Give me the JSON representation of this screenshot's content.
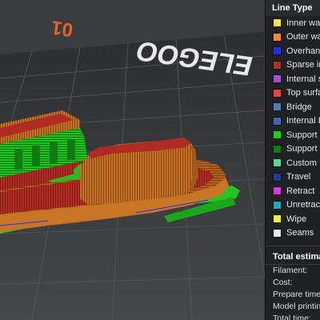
{
  "bed": {
    "logo_text": "ELEGOO",
    "plate_number": "01",
    "accent_color": "#e8622a"
  },
  "legend": {
    "title": "Line Type",
    "items": [
      {
        "label": "Inner wal",
        "color": "#ffe24a",
        "icon": "square-swatch"
      },
      {
        "label": "Outer wal",
        "color": "#f08a3a",
        "icon": "square-swatch"
      },
      {
        "label": "Overhang",
        "color": "#2430e0",
        "icon": "square-swatch"
      },
      {
        "label": "Sparse in",
        "color": "#a8332c",
        "icon": "square-swatch"
      },
      {
        "label": "Internal s",
        "color": "#a34fd6",
        "icon": "square-swatch"
      },
      {
        "label": "Top surfa",
        "color": "#e0463d",
        "icon": "square-swatch"
      },
      {
        "label": "Bridge",
        "color": "#4f7fb0",
        "icon": "square-swatch"
      },
      {
        "label": "Internal B",
        "color": "#3a6aa8",
        "icon": "square-swatch"
      },
      {
        "label": "Support",
        "color": "#19d11c",
        "icon": "square-swatch"
      },
      {
        "label": "Support i",
        "color": "#0f7a12",
        "icon": "square-swatch"
      },
      {
        "label": "Custom",
        "color": "#5fcf9e",
        "icon": "square-swatch"
      },
      {
        "label": "Travel",
        "color": "#253a8c",
        "icon": "square-swatch"
      },
      {
        "label": "Retract",
        "color": "#d63ad6",
        "icon": "square-swatch"
      },
      {
        "label": "Unretract",
        "color": "#2aa6b8",
        "icon": "square-swatch"
      },
      {
        "label": "Wipe",
        "color": "#f5f23a",
        "icon": "square-swatch"
      },
      {
        "label": "Seams",
        "color": "#e8e8e8",
        "icon": "square-swatch"
      }
    ]
  },
  "estimates": {
    "title": "Total estima",
    "rows": [
      {
        "label": "Filament:"
      },
      {
        "label": "Cost:"
      },
      {
        "label": "Prepare time"
      },
      {
        "label": "Model printin"
      },
      {
        "label": "Total time:"
      }
    ]
  }
}
